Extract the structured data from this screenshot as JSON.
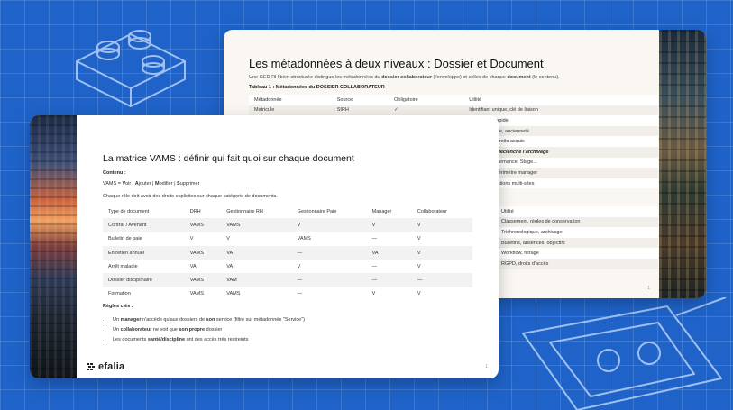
{
  "colors": {
    "background": "#1f63c9",
    "grid_line": "#ffffff",
    "deco_line": "#9fc0f0",
    "slide": "#faf7f2"
  },
  "back_slide": {
    "title": "Les métadonnées à deux niveaux : Dossier et Document",
    "intro": {
      "p1": "Une GED RH bien structurée distingue les métadonnées du ",
      "b1": "dossier collaborateur",
      "p2": " (l'enveloppe) et celles de chaque ",
      "b2": "document",
      "p3": " (le contenu)."
    },
    "table_caption": "Tableau 1 : Métadonnées du DOSSIER COLLABORATEUR",
    "table1": {
      "headers": [
        "Métadonnée",
        "Source",
        "Obligatoire",
        "Utilité"
      ],
      "rows": [
        [
          "Matricule",
          "SIRH",
          "✓",
          "Identifiant unique, clé de liaison"
        ],
        [
          "",
          "",
          "",
          "Recherche rapide"
        ],
        [
          "",
          "",
          "",
          "Calculs retraite, ancienneté"
        ],
        [
          "",
          "",
          "",
          "Ancienneté, droits acquis"
        ],
        [
          "",
          "",
          "",
          "CRITIQUE : déclenche l'archivage"
        ],
        [
          "",
          "",
          "",
          "CDI, CDD, Alternance, Stage..."
        ],
        [
          "",
          "",
          "",
          "Filtrage par périmètre manager"
        ],
        [
          "",
          "",
          "",
          "Pour organisations multi-sites"
        ]
      ]
    },
    "table2": {
      "header": "Utilité",
      "rows": [
        "Classement, règles de conservation",
        "Trichronologique, archivage",
        "Bulletins, absences, objectifs",
        "Workflow, filtrage",
        "RGPD, droits d'accès"
      ]
    },
    "page_number": "1"
  },
  "front_slide": {
    "title": "La matrice VAMS : définir qui fait quoi sur chaque document",
    "contenu_label": "Contenu :",
    "vams": {
      "a": "VAMS = ",
      "v": "V",
      "b": "oir | ",
      "aj": "A",
      "c": "jouter | ",
      "m": "M",
      "d": "odifier | ",
      "s": "S",
      "e": "upprimer"
    },
    "intro": "Chaque rôle doit avoir des droits explicites sur chaque catégorie de documents.",
    "table": {
      "headers": [
        "Type de document",
        "DRH",
        "Gestionnaire RH",
        "Gestionnaire Paie",
        "Manager",
        "Collaborateur"
      ],
      "rows": [
        [
          "Contrat / Avenant",
          "VAMS",
          "VAMS",
          "V",
          "V",
          "V"
        ],
        [
          "Bulletin de paie",
          "V",
          "V",
          "VAMS",
          "—",
          "V"
        ],
        [
          "Entretien annuel",
          "VAMS",
          "VA",
          "—",
          "VA",
          "V"
        ],
        [
          "Arrêt maladie",
          "VA",
          "VA",
          "V",
          "—",
          "V"
        ],
        [
          "Dossier disciplinaire",
          "VAMS",
          "VAM",
          "—",
          "—",
          "—"
        ],
        [
          "Formation",
          "VAMS",
          "VAMS",
          "—",
          "V",
          "V"
        ]
      ]
    },
    "rules_label": "Règles clés :",
    "rules": [
      {
        "a": "Un ",
        "b": "manager",
        "c": " n'accède qu'aux dossiers de ",
        "d": "son",
        "e": " service (filtre sur métadonnée \"Service\")"
      },
      {
        "a": "Un ",
        "b": "collaborateur",
        "c": " ne voit que ",
        "d": "son propre",
        "e": " dossier"
      },
      {
        "a": "Les documents ",
        "b": "santé/discipline",
        "c": " ont des accès très restreints",
        "d": "",
        "e": ""
      }
    ],
    "logo_text": "efalia",
    "page_number": "1"
  }
}
